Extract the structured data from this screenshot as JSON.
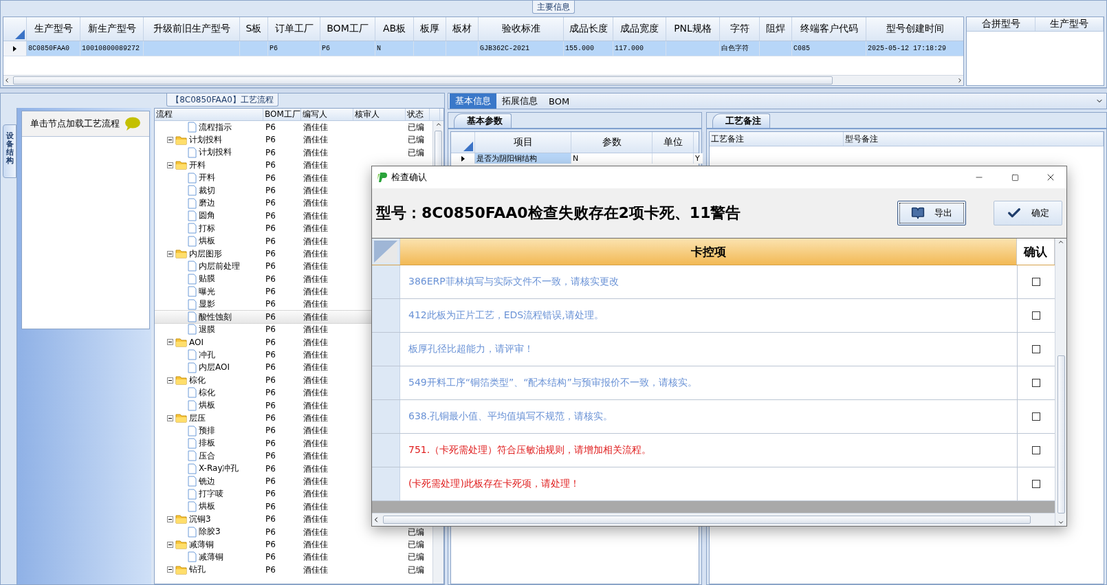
{
  "main_info": {
    "title": "主要信息",
    "columns": [
      "生产型号",
      "新生产型号",
      "升级前旧生产型号",
      "S板",
      "订单工厂",
      "BOM工厂",
      "AB板",
      "板厚",
      "板材",
      "验收标准",
      "成品长度",
      "成品宽度",
      "PNL规格",
      "字符",
      "阻焊",
      "终端客户代码",
      "型号创建时间"
    ],
    "rows": [
      {
        "selected": true,
        "cells": [
          "8C0850FAA0",
          "10010800089272",
          "",
          "",
          "P6",
          "P6",
          "N",
          "",
          "",
          "GJB362C-2021",
          "155.000",
          "117.000",
          "",
          "白色字符",
          "",
          "C085",
          "2025-05-12 17:18:29"
        ]
      }
    ],
    "side_columns": [
      "合拼型号",
      "生产型号"
    ]
  },
  "process_flow": {
    "title": "【8C0850FAA0】工艺流程",
    "side_tab": "设备结构",
    "hint": "单击节点加载工艺流程",
    "columns": [
      "流程",
      "BOM工厂",
      "编写人",
      "核审人",
      "状态"
    ],
    "nodes": [
      {
        "kind": "item",
        "name": "流程指示",
        "bom": "P6",
        "author": "酒佳佳",
        "status": "已编",
        "selected": false
      },
      {
        "kind": "folder",
        "name": "计划投料",
        "bom": "P6",
        "author": "酒佳佳",
        "status": "已编",
        "expanded": true,
        "selected": false,
        "children": [
          {
            "kind": "item",
            "name": "计划投料",
            "bom": "P6",
            "author": "酒佳佳",
            "status": "已编",
            "selected": false
          }
        ]
      },
      {
        "kind": "folder",
        "name": "开料",
        "bom": "P6",
        "author": "酒佳佳",
        "expanded": true,
        "selected": false,
        "children": [
          {
            "kind": "item",
            "name": "开料",
            "bom": "P6",
            "author": "酒佳佳",
            "selected": false
          },
          {
            "kind": "item",
            "name": "裁切",
            "bom": "P6",
            "author": "酒佳佳",
            "selected": false
          },
          {
            "kind": "item",
            "name": "磨边",
            "bom": "P6",
            "author": "酒佳佳",
            "selected": false
          },
          {
            "kind": "item",
            "name": "圆角",
            "bom": "P6",
            "author": "酒佳佳",
            "selected": false
          },
          {
            "kind": "item",
            "name": "打标",
            "bom": "P6",
            "author": "酒佳佳",
            "selected": false
          },
          {
            "kind": "item",
            "name": "烘板",
            "bom": "P6",
            "author": "酒佳佳",
            "selected": false
          }
        ]
      },
      {
        "kind": "folder",
        "name": "内层图形",
        "bom": "P6",
        "author": "酒佳佳",
        "expanded": true,
        "selected": false,
        "children": [
          {
            "kind": "item",
            "name": "内层前处理",
            "bom": "P6",
            "author": "酒佳佳",
            "selected": false
          },
          {
            "kind": "item",
            "name": "贴膜",
            "bom": "P6",
            "author": "酒佳佳",
            "selected": false
          },
          {
            "kind": "item",
            "name": "曝光",
            "bom": "P6",
            "author": "酒佳佳",
            "selected": false
          },
          {
            "kind": "item",
            "name": "显影",
            "bom": "P6",
            "author": "酒佳佳",
            "selected": false
          },
          {
            "kind": "item",
            "name": "酸性蚀刻",
            "bom": "P6",
            "author": "酒佳佳",
            "selected": true
          },
          {
            "kind": "item",
            "name": "退膜",
            "bom": "P6",
            "author": "酒佳佳",
            "selected": false
          }
        ]
      },
      {
        "kind": "folder",
        "name": "AOI",
        "bom": "P6",
        "author": "酒佳佳",
        "expanded": true,
        "selected": false,
        "children": [
          {
            "kind": "item",
            "name": "冲孔",
            "bom": "P6",
            "author": "酒佳佳",
            "selected": false
          },
          {
            "kind": "item",
            "name": "内层AOI",
            "bom": "P6",
            "author": "酒佳佳",
            "selected": false
          }
        ]
      },
      {
        "kind": "folder",
        "name": "棕化",
        "bom": "P6",
        "author": "酒佳佳",
        "expanded": true,
        "selected": false,
        "children": [
          {
            "kind": "item",
            "name": "棕化",
            "bom": "P6",
            "author": "酒佳佳",
            "selected": false
          },
          {
            "kind": "item",
            "name": "烘板",
            "bom": "P6",
            "author": "酒佳佳",
            "selected": false
          }
        ]
      },
      {
        "kind": "folder",
        "name": "层压",
        "bom": "P6",
        "author": "酒佳佳",
        "expanded": true,
        "selected": false,
        "children": [
          {
            "kind": "item",
            "name": "预排",
            "bom": "P6",
            "author": "酒佳佳",
            "selected": false
          },
          {
            "kind": "item",
            "name": "排板",
            "bom": "P6",
            "author": "酒佳佳",
            "selected": false
          },
          {
            "kind": "item",
            "name": "压合",
            "bom": "P6",
            "author": "酒佳佳",
            "selected": false
          },
          {
            "kind": "item",
            "name": "X-Ray冲孔",
            "bom": "P6",
            "author": "酒佳佳",
            "selected": false
          },
          {
            "kind": "item",
            "name": "铣边",
            "bom": "P6",
            "author": "酒佳佳",
            "selected": false
          },
          {
            "kind": "item",
            "name": "打字唛",
            "bom": "P6",
            "author": "酒佳佳",
            "selected": false
          },
          {
            "kind": "item",
            "name": "烘板",
            "bom": "P6",
            "author": "酒佳佳",
            "selected": false
          }
        ]
      },
      {
        "kind": "folder",
        "name": "沉铜3",
        "bom": "P6",
        "author": "酒佳佳",
        "expanded": true,
        "selected": false,
        "children": [
          {
            "kind": "item",
            "name": "除胶3",
            "bom": "P6",
            "author": "酒佳佳",
            "status": "已编",
            "selected": false
          }
        ]
      },
      {
        "kind": "folder",
        "name": "减薄铜",
        "bom": "P6",
        "author": "酒佳佳",
        "status": "已编",
        "expanded": true,
        "selected": false,
        "children": [
          {
            "kind": "item",
            "name": "减薄铜",
            "bom": "P6",
            "author": "酒佳佳",
            "status": "已编",
            "selected": false
          }
        ]
      },
      {
        "kind": "folder",
        "name": "钻孔",
        "bom": "P6",
        "author": "酒佳佳",
        "status": "已编",
        "expanded": true,
        "selected": false
      }
    ]
  },
  "detail_tabs": [
    {
      "label": "基本信息",
      "selected": true
    },
    {
      "label": "拓展信息",
      "selected": false
    },
    {
      "label": "BOM",
      "selected": false
    }
  ],
  "basic_params": {
    "tab": "基本参数",
    "columns": [
      "项目",
      "参数",
      "单位"
    ],
    "rows": [
      {
        "cells": [
          "是否为阴阳铜结构",
          "N",
          "",
          "Y"
        ]
      }
    ]
  },
  "process_notes": {
    "tab": "工艺备注",
    "columns": [
      "工艺备注",
      "型号备注"
    ]
  },
  "dialog": {
    "title": "检查确认",
    "heading": "型号：8C0850FAA0检查失败存在2项卡死、11警告",
    "buttons": [
      {
        "label": "导出",
        "kind": "export",
        "focused": true
      },
      {
        "label": "确定",
        "kind": "confirm",
        "focused": false
      }
    ],
    "columns": [
      "卡控项",
      "确认"
    ],
    "rows": [
      {
        "text": "386ERP菲林填写与实际文件不一致，请核实更改",
        "kind": "warning",
        "checked": false
      },
      {
        "text": "412此板为正片工艺，EDS流程错误,请处理。",
        "kind": "warning",
        "checked": false
      },
      {
        "text": "板厚孔径比超能力，请评审！",
        "kind": "warning",
        "checked": false
      },
      {
        "text": "549开料工序“铜箔类型”、“配本结构”与预审报价不一致，请核实。",
        "kind": "warning",
        "checked": false
      },
      {
        "text": "638.孔铜最小值、平均值填写不规范，请核实。",
        "kind": "warning",
        "checked": false
      },
      {
        "text": "751.（卡死需处理）符合压敏油规则，请增加相关流程。",
        "kind": "blocking",
        "checked": false
      },
      {
        "text": "(卡死需处理)此板存在卡死项，请处理！",
        "kind": "blocking",
        "checked": false
      }
    ]
  }
}
